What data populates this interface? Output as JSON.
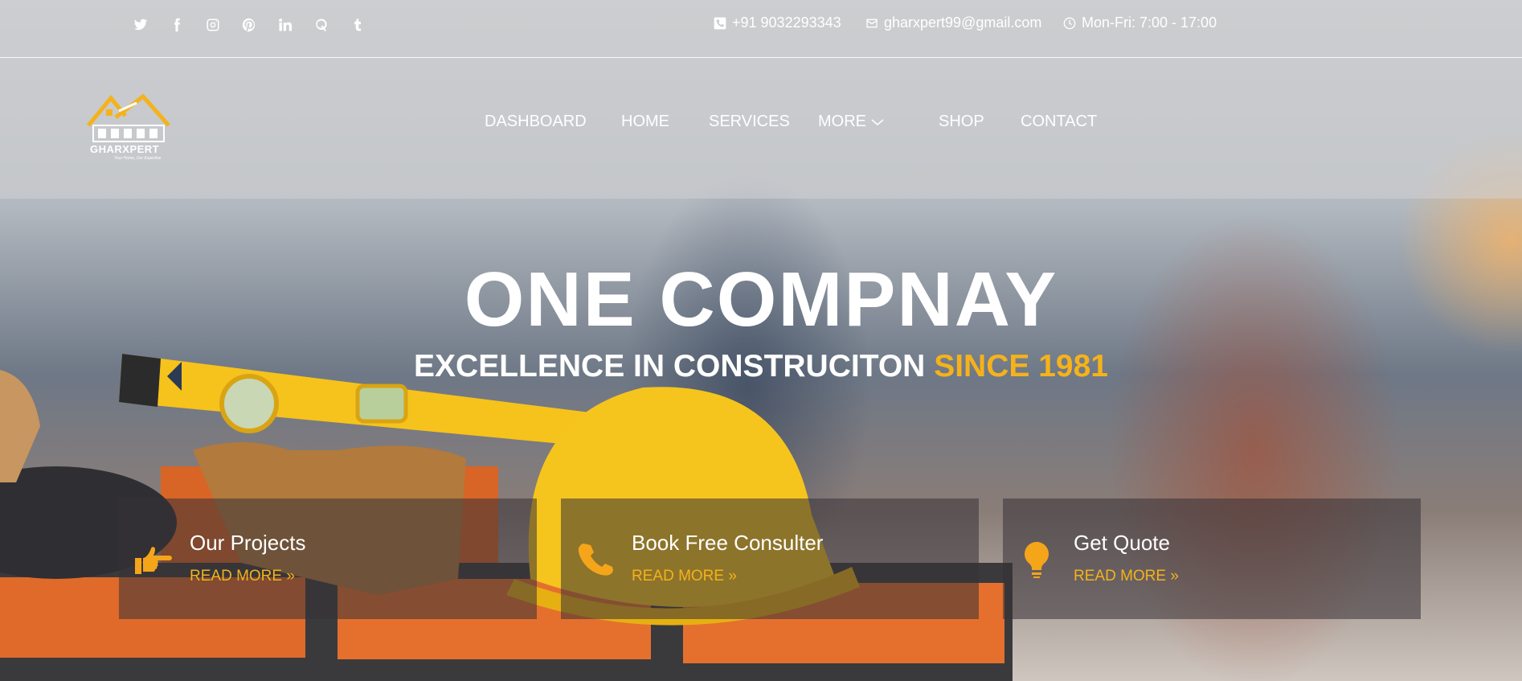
{
  "social": [
    "twitter-icon",
    "facebook-icon",
    "instagram-icon",
    "pinterest-icon",
    "linkedin-icon",
    "quora-icon",
    "tumblr-icon"
  ],
  "contact": {
    "phone": "+91 9032293343",
    "email": "gharxpert99@gmail.com",
    "hours": "Mon-Fri: 7:00 - 17:00"
  },
  "logo": {
    "name": "GHARXPERT",
    "tagline": "Your Home, Our Expertise"
  },
  "nav": [
    "DASHBOARD",
    "HOME",
    "SERVICES",
    "MORE",
    "SHOP",
    "CONTACT"
  ],
  "hero": {
    "title": "ONE COMPNAY",
    "subtitle_main": "EXCELLENCE IN CONSTRUCITON",
    "subtitle_accent": "SINCE 1981"
  },
  "cards": [
    {
      "title": "Our Projects",
      "link": "READ MORE »",
      "icon": "pointing-hand-icon"
    },
    {
      "title": "Book Free Consulter",
      "link": "READ MORE »",
      "icon": "phone-icon"
    },
    {
      "title": "Get Quote",
      "link": "READ MORE »",
      "icon": "lightbulb-icon"
    }
  ],
  "colors": {
    "accent": "#f5b21a",
    "icon_accent": "#f5a51a",
    "text": "#ffffff"
  }
}
